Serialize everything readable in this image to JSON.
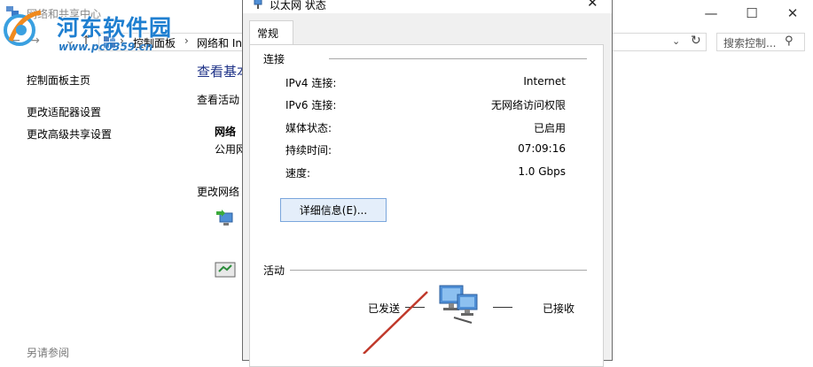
{
  "background_window": {
    "title": "网络和共享中心",
    "breadcrumb": [
      "控制面板",
      "网络和 In"
    ],
    "search_placeholder": "搜索控制...",
    "side_links": [
      "控制面板主页",
      "更改适配器设置",
      "更改高级共享设置"
    ],
    "see_also": "另请参阅",
    "main_title": "查看基本",
    "view_active": "查看活动",
    "network_label": "网络",
    "public_network": "公用网",
    "change_network": "更改网络"
  },
  "watermark": {
    "name": "河东软件园",
    "url": "www.pc0359.cn"
  },
  "dialog": {
    "title": "以太网 状态",
    "tab": "常规",
    "connection_group": "连接",
    "rows": [
      {
        "label": "IPv4 连接:",
        "value": "Internet"
      },
      {
        "label": "IPv6 连接:",
        "value": "无网络访问权限"
      },
      {
        "label": "媒体状态:",
        "value": "已启用"
      },
      {
        "label": "持续时间:",
        "value": "07:09:16"
      },
      {
        "label": "速度:",
        "value": "1.0 Gbps"
      }
    ],
    "details_button": "详细信息(E)...",
    "activity_group": "活动",
    "sent_label": "已发送",
    "received_label": "已接收"
  },
  "colors": {
    "title_blue": "#1e3287",
    "watermark_blue": "#1f7fd0",
    "annotation_red": "#c0392b"
  }
}
